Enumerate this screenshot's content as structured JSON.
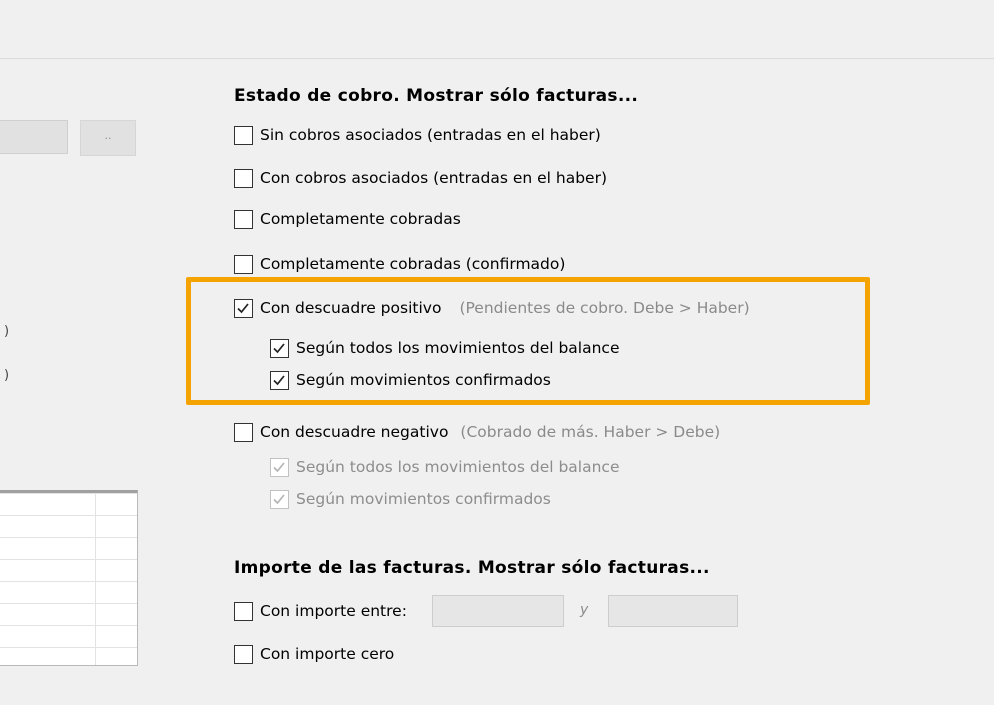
{
  "left_panel": {
    "button_label": "..",
    "tick_1": ")",
    "tick_2": ")"
  },
  "estado": {
    "title": "Estado de cobro. Mostrar sólo facturas...",
    "sin_cobros": "Sin cobros asociados (entradas en el haber)",
    "con_cobros": "Con cobros asociados (entradas en el haber)",
    "completamente": "Completamente cobradas",
    "completamente_conf": "Completamente cobradas (confirmado)",
    "positivo": "Con descuadre positivo",
    "positivo_hint": "(Pendientes de cobro. Debe > Haber)",
    "positivo_todos": "Según todos los movimientos del balance",
    "positivo_confirmados": "Según movimientos confirmados",
    "negativo": "Con descuadre negativo",
    "negativo_hint": "(Cobrado de más. Haber > Debe)",
    "negativo_todos": "Según todos los movimientos del balance",
    "negativo_confirmados": "Según movimientos confirmados"
  },
  "importe": {
    "title": "Importe de las facturas. Mostrar sólo facturas...",
    "entre": "Con importe entre:",
    "y": "y",
    "cero": "Con importe cero",
    "from_value": "",
    "to_value": ""
  },
  "colors": {
    "highlight": "#f5a300"
  }
}
